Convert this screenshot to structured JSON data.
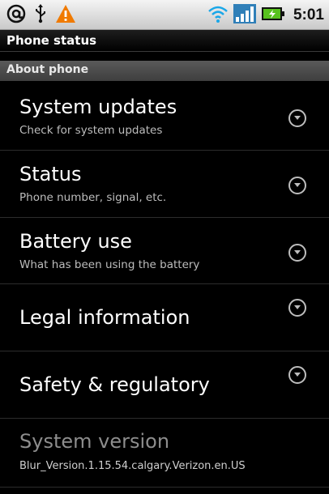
{
  "status_bar": {
    "left_icons": [
      "at-sign-icon",
      "usb-icon",
      "warning-icon"
    ],
    "right_icons": [
      "wifi-icon",
      "signal-icon",
      "battery-charging-icon"
    ],
    "time": "5:01"
  },
  "title_bar": {
    "title": "Phone status"
  },
  "section": {
    "label": "About phone"
  },
  "items": [
    {
      "title": "System updates",
      "subtitle": "Check for system updates"
    },
    {
      "title": "Status",
      "subtitle": "Phone number, signal, etc."
    },
    {
      "title": "Battery use",
      "subtitle": "What has been using the battery"
    },
    {
      "title": "Legal information"
    },
    {
      "title": "Safety & regulatory"
    },
    {
      "title": "System version",
      "subtitle": "Blur_Version.1.15.54.calgary.Verizon.en.US"
    }
  ],
  "colors": {
    "accent_warning": "#f07a00",
    "wifi": "#1aa7e8",
    "signal": "#2f7fb8",
    "battery": "#58c21e"
  }
}
